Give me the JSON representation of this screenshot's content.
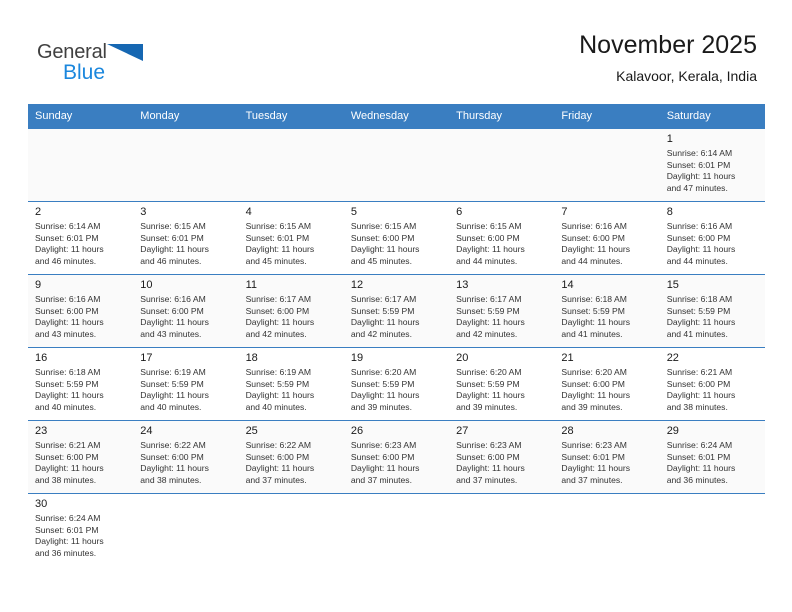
{
  "brand": {
    "name_top": "General",
    "name_bottom": "Blue",
    "flag_color": "#1667b2",
    "blue_color": "#1b87dd"
  },
  "header": {
    "title": "November 2025",
    "subtitle": "Kalavoor, Kerala, India",
    "accent_color": "#3a7ec1"
  },
  "calendar": {
    "weekday_headers": [
      "Sunday",
      "Monday",
      "Tuesday",
      "Wednesday",
      "Thursday",
      "Friday",
      "Saturday"
    ],
    "labels": {
      "sunrise": "Sunrise:",
      "sunset": "Sunset:",
      "daylight": "Daylight:"
    },
    "weeks": [
      [
        {
          "day": "",
          "sunrise": "",
          "sunset": "",
          "daylight_line1": "",
          "daylight_line2": ""
        },
        {
          "day": "",
          "sunrise": "",
          "sunset": "",
          "daylight_line1": "",
          "daylight_line2": ""
        },
        {
          "day": "",
          "sunrise": "",
          "sunset": "",
          "daylight_line1": "",
          "daylight_line2": ""
        },
        {
          "day": "",
          "sunrise": "",
          "sunset": "",
          "daylight_line1": "",
          "daylight_line2": ""
        },
        {
          "day": "",
          "sunrise": "",
          "sunset": "",
          "daylight_line1": "",
          "daylight_line2": ""
        },
        {
          "day": "",
          "sunrise": "",
          "sunset": "",
          "daylight_line1": "",
          "daylight_line2": ""
        },
        {
          "day": "1",
          "sunrise": "Sunrise: 6:14 AM",
          "sunset": "Sunset: 6:01 PM",
          "daylight_line1": "Daylight: 11 hours",
          "daylight_line2": "and 47 minutes."
        }
      ],
      [
        {
          "day": "2",
          "sunrise": "Sunrise: 6:14 AM",
          "sunset": "Sunset: 6:01 PM",
          "daylight_line1": "Daylight: 11 hours",
          "daylight_line2": "and 46 minutes."
        },
        {
          "day": "3",
          "sunrise": "Sunrise: 6:15 AM",
          "sunset": "Sunset: 6:01 PM",
          "daylight_line1": "Daylight: 11 hours",
          "daylight_line2": "and 46 minutes."
        },
        {
          "day": "4",
          "sunrise": "Sunrise: 6:15 AM",
          "sunset": "Sunset: 6:01 PM",
          "daylight_line1": "Daylight: 11 hours",
          "daylight_line2": "and 45 minutes."
        },
        {
          "day": "5",
          "sunrise": "Sunrise: 6:15 AM",
          "sunset": "Sunset: 6:00 PM",
          "daylight_line1": "Daylight: 11 hours",
          "daylight_line2": "and 45 minutes."
        },
        {
          "day": "6",
          "sunrise": "Sunrise: 6:15 AM",
          "sunset": "Sunset: 6:00 PM",
          "daylight_line1": "Daylight: 11 hours",
          "daylight_line2": "and 44 minutes."
        },
        {
          "day": "7",
          "sunrise": "Sunrise: 6:16 AM",
          "sunset": "Sunset: 6:00 PM",
          "daylight_line1": "Daylight: 11 hours",
          "daylight_line2": "and 44 minutes."
        },
        {
          "day": "8",
          "sunrise": "Sunrise: 6:16 AM",
          "sunset": "Sunset: 6:00 PM",
          "daylight_line1": "Daylight: 11 hours",
          "daylight_line2": "and 44 minutes."
        }
      ],
      [
        {
          "day": "9",
          "sunrise": "Sunrise: 6:16 AM",
          "sunset": "Sunset: 6:00 PM",
          "daylight_line1": "Daylight: 11 hours",
          "daylight_line2": "and 43 minutes."
        },
        {
          "day": "10",
          "sunrise": "Sunrise: 6:16 AM",
          "sunset": "Sunset: 6:00 PM",
          "daylight_line1": "Daylight: 11 hours",
          "daylight_line2": "and 43 minutes."
        },
        {
          "day": "11",
          "sunrise": "Sunrise: 6:17 AM",
          "sunset": "Sunset: 6:00 PM",
          "daylight_line1": "Daylight: 11 hours",
          "daylight_line2": "and 42 minutes."
        },
        {
          "day": "12",
          "sunrise": "Sunrise: 6:17 AM",
          "sunset": "Sunset: 5:59 PM",
          "daylight_line1": "Daylight: 11 hours",
          "daylight_line2": "and 42 minutes."
        },
        {
          "day": "13",
          "sunrise": "Sunrise: 6:17 AM",
          "sunset": "Sunset: 5:59 PM",
          "daylight_line1": "Daylight: 11 hours",
          "daylight_line2": "and 42 minutes."
        },
        {
          "day": "14",
          "sunrise": "Sunrise: 6:18 AM",
          "sunset": "Sunset: 5:59 PM",
          "daylight_line1": "Daylight: 11 hours",
          "daylight_line2": "and 41 minutes."
        },
        {
          "day": "15",
          "sunrise": "Sunrise: 6:18 AM",
          "sunset": "Sunset: 5:59 PM",
          "daylight_line1": "Daylight: 11 hours",
          "daylight_line2": "and 41 minutes."
        }
      ],
      [
        {
          "day": "16",
          "sunrise": "Sunrise: 6:18 AM",
          "sunset": "Sunset: 5:59 PM",
          "daylight_line1": "Daylight: 11 hours",
          "daylight_line2": "and 40 minutes."
        },
        {
          "day": "17",
          "sunrise": "Sunrise: 6:19 AM",
          "sunset": "Sunset: 5:59 PM",
          "daylight_line1": "Daylight: 11 hours",
          "daylight_line2": "and 40 minutes."
        },
        {
          "day": "18",
          "sunrise": "Sunrise: 6:19 AM",
          "sunset": "Sunset: 5:59 PM",
          "daylight_line1": "Daylight: 11 hours",
          "daylight_line2": "and 40 minutes."
        },
        {
          "day": "19",
          "sunrise": "Sunrise: 6:20 AM",
          "sunset": "Sunset: 5:59 PM",
          "daylight_line1": "Daylight: 11 hours",
          "daylight_line2": "and 39 minutes."
        },
        {
          "day": "20",
          "sunrise": "Sunrise: 6:20 AM",
          "sunset": "Sunset: 5:59 PM",
          "daylight_line1": "Daylight: 11 hours",
          "daylight_line2": "and 39 minutes."
        },
        {
          "day": "21",
          "sunrise": "Sunrise: 6:20 AM",
          "sunset": "Sunset: 6:00 PM",
          "daylight_line1": "Daylight: 11 hours",
          "daylight_line2": "and 39 minutes."
        },
        {
          "day": "22",
          "sunrise": "Sunrise: 6:21 AM",
          "sunset": "Sunset: 6:00 PM",
          "daylight_line1": "Daylight: 11 hours",
          "daylight_line2": "and 38 minutes."
        }
      ],
      [
        {
          "day": "23",
          "sunrise": "Sunrise: 6:21 AM",
          "sunset": "Sunset: 6:00 PM",
          "daylight_line1": "Daylight: 11 hours",
          "daylight_line2": "and 38 minutes."
        },
        {
          "day": "24",
          "sunrise": "Sunrise: 6:22 AM",
          "sunset": "Sunset: 6:00 PM",
          "daylight_line1": "Daylight: 11 hours",
          "daylight_line2": "and 38 minutes."
        },
        {
          "day": "25",
          "sunrise": "Sunrise: 6:22 AM",
          "sunset": "Sunset: 6:00 PM",
          "daylight_line1": "Daylight: 11 hours",
          "daylight_line2": "and 37 minutes."
        },
        {
          "day": "26",
          "sunrise": "Sunrise: 6:23 AM",
          "sunset": "Sunset: 6:00 PM",
          "daylight_line1": "Daylight: 11 hours",
          "daylight_line2": "and 37 minutes."
        },
        {
          "day": "27",
          "sunrise": "Sunrise: 6:23 AM",
          "sunset": "Sunset: 6:00 PM",
          "daylight_line1": "Daylight: 11 hours",
          "daylight_line2": "and 37 minutes."
        },
        {
          "day": "28",
          "sunrise": "Sunrise: 6:23 AM",
          "sunset": "Sunset: 6:01 PM",
          "daylight_line1": "Daylight: 11 hours",
          "daylight_line2": "and 37 minutes."
        },
        {
          "day": "29",
          "sunrise": "Sunrise: 6:24 AM",
          "sunset": "Sunset: 6:01 PM",
          "daylight_line1": "Daylight: 11 hours",
          "daylight_line2": "and 36 minutes."
        }
      ],
      [
        {
          "day": "30",
          "sunrise": "Sunrise: 6:24 AM",
          "sunset": "Sunset: 6:01 PM",
          "daylight_line1": "Daylight: 11 hours",
          "daylight_line2": "and 36 minutes."
        },
        {
          "day": "",
          "sunrise": "",
          "sunset": "",
          "daylight_line1": "",
          "daylight_line2": ""
        },
        {
          "day": "",
          "sunrise": "",
          "sunset": "",
          "daylight_line1": "",
          "daylight_line2": ""
        },
        {
          "day": "",
          "sunrise": "",
          "sunset": "",
          "daylight_line1": "",
          "daylight_line2": ""
        },
        {
          "day": "",
          "sunrise": "",
          "sunset": "",
          "daylight_line1": "",
          "daylight_line2": ""
        },
        {
          "day": "",
          "sunrise": "",
          "sunset": "",
          "daylight_line1": "",
          "daylight_line2": ""
        },
        {
          "day": "",
          "sunrise": "",
          "sunset": "",
          "daylight_line1": "",
          "daylight_line2": ""
        }
      ]
    ]
  }
}
